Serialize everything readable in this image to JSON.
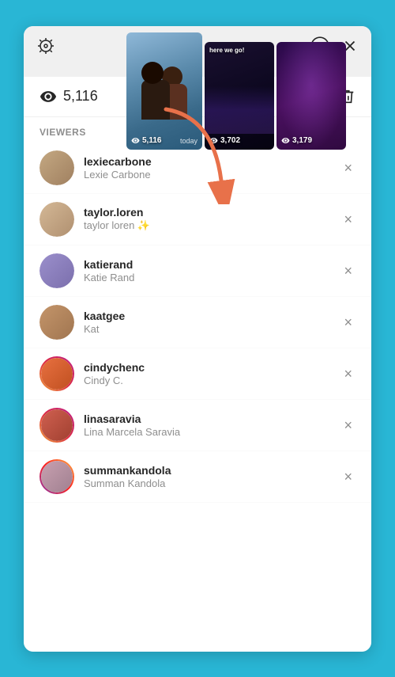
{
  "header": {
    "gear_label": "settings",
    "download_label": "download",
    "close_label": "close"
  },
  "story_strip": {
    "thumbnails": [
      {
        "id": "thumb1",
        "type": "photo",
        "count": "5,116",
        "active": true,
        "text": "today"
      },
      {
        "id": "thumb2",
        "type": "concert",
        "text": "here we go!",
        "count": "3,702",
        "active": false
      },
      {
        "id": "thumb3",
        "type": "concert2",
        "text": "",
        "count": "3,179",
        "active": false
      }
    ]
  },
  "stats": {
    "eye_icon": "eye-icon",
    "view_count": "5,116",
    "download_icon": "download-icon",
    "share_icon": "share-icon",
    "delete_icon": "delete-icon"
  },
  "viewers_section": {
    "header": "VIEWERS",
    "items": [
      {
        "username": "lexiecarbone",
        "fullname": "Lexie Carbone",
        "avatar_class": "av1",
        "has_story_ring": false,
        "ring_type": ""
      },
      {
        "username": "taylor.loren",
        "fullname": "taylor loren ✨",
        "avatar_class": "av2",
        "has_story_ring": false,
        "ring_type": ""
      },
      {
        "username": "katierand",
        "fullname": "Katie Rand",
        "avatar_class": "av3",
        "has_story_ring": false,
        "ring_type": ""
      },
      {
        "username": "kaatgee",
        "fullname": "Kat",
        "avatar_class": "av4",
        "has_story_ring": false,
        "ring_type": ""
      },
      {
        "username": "cindychenc",
        "fullname": "Cindy C.",
        "avatar_class": "av5",
        "has_story_ring": true,
        "ring_type": "ring1"
      },
      {
        "username": "linasaravia",
        "fullname": "Lina Marcela Saravia",
        "avatar_class": "av6",
        "has_story_ring": true,
        "ring_type": "ring1"
      },
      {
        "username": "summankandola",
        "fullname": "Summan Kandola",
        "avatar_class": "av7",
        "has_story_ring": true,
        "ring_type": "ring2"
      }
    ]
  }
}
